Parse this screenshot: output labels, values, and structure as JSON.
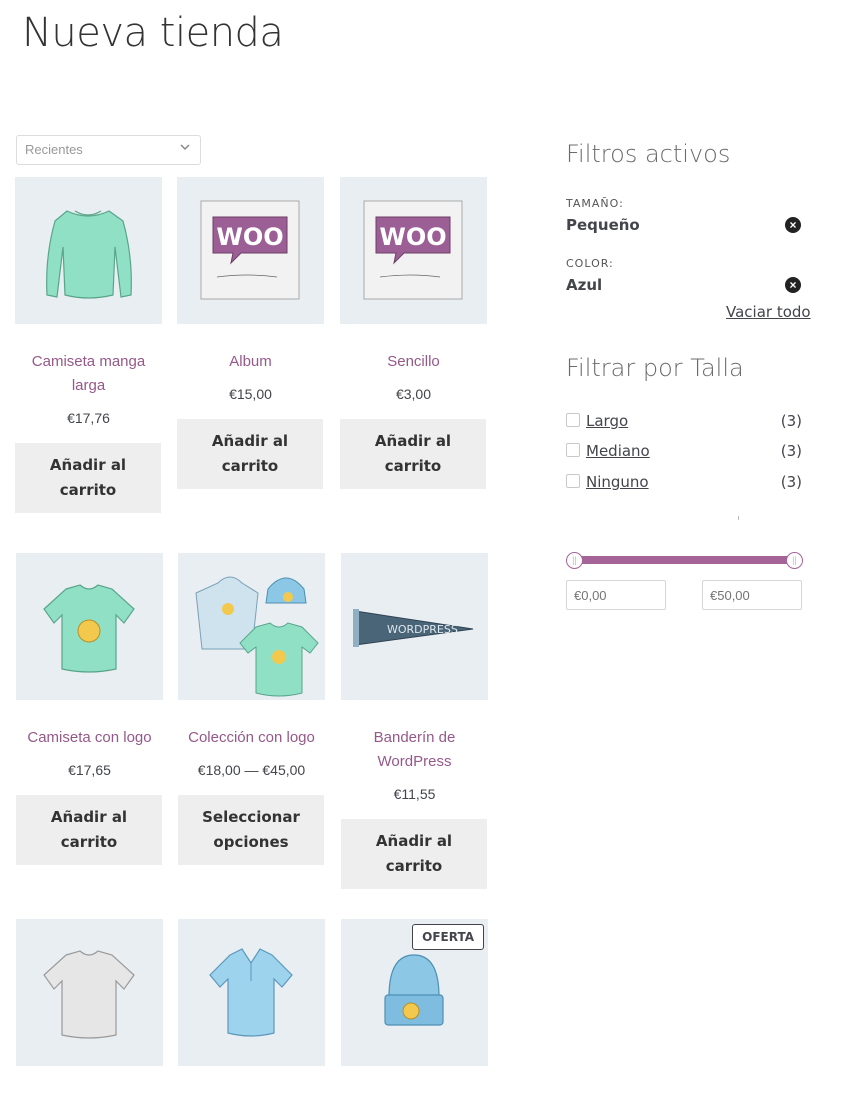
{
  "page": {
    "title": "Nueva tienda"
  },
  "ordering": {
    "selected": "Recientes"
  },
  "products": [
    {
      "title": "Camiseta manga larga",
      "price": "€17,76",
      "button": "Añadir al carrito",
      "image": "long-sleeve-tee"
    },
    {
      "title": "Album",
      "price": "€15,00",
      "button": "Añadir al carrito",
      "image": "woo-album"
    },
    {
      "title": "Sencillo",
      "price": "€3,00",
      "button": "Añadir al carrito",
      "image": "woo-single"
    },
    {
      "title": "Camiseta con logo",
      "price": "€17,65",
      "button": "Añadir al carrito",
      "image": "logo-tshirt"
    },
    {
      "title": "Colección con logo",
      "price": "€18,00 — €45,00",
      "button": "Seleccionar opciones",
      "image": "logo-collection"
    },
    {
      "title": "Banderín de WordPress",
      "price": "€11,55",
      "button": "Añadir al carrito",
      "image": "wordpress-pennant"
    },
    {
      "title": "",
      "price": "",
      "button": "",
      "image": "grey-tshirt"
    },
    {
      "title": "",
      "price": "",
      "button": "",
      "image": "polo"
    },
    {
      "title": "",
      "price": "",
      "button": "",
      "image": "beanie",
      "badge": "OFERTA"
    }
  ],
  "active_filters": {
    "title": "Filtros activos",
    "items": [
      {
        "label": "TAMAÑO:",
        "value": "Pequeño"
      },
      {
        "label": "COLOR:",
        "value": "Azul"
      }
    ],
    "clear": "Vaciar todo"
  },
  "size_filter": {
    "title": "Filtrar por Talla",
    "options": [
      {
        "label": "Largo",
        "count": "(3)"
      },
      {
        "label": "Mediano",
        "count": "(3)"
      },
      {
        "label": "Ninguno",
        "count": "(3)"
      }
    ]
  },
  "price_filter": {
    "min_placeholder": "€0,00",
    "max_placeholder": "€50,00",
    "range_min": 0,
    "range_max": 50,
    "accent": "#a46497"
  },
  "colors": {
    "accent": "#96588a",
    "button_bg": "#eeeeee",
    "thumb_bg": "#e8eef2"
  }
}
